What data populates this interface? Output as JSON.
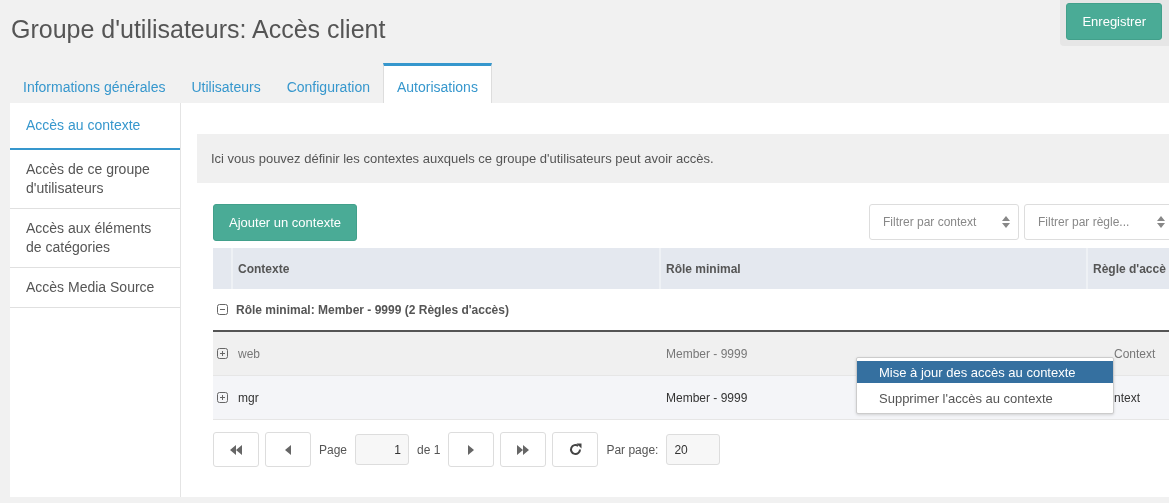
{
  "page_title": "Groupe d'utilisateurs: Accès client",
  "save_button": "Enregistrer",
  "tabs": [
    {
      "label": "Informations générales",
      "selected": false
    },
    {
      "label": "Utilisateurs",
      "selected": false
    },
    {
      "label": "Configuration",
      "selected": false
    },
    {
      "label": "Autorisations",
      "selected": true
    }
  ],
  "sidebar": {
    "items": [
      {
        "label": "Accès au contexte",
        "selected": true
      },
      {
        "label": "Accès de ce groupe d'utilisateurs",
        "selected": false
      },
      {
        "label": "Accès aux éléments de catégories",
        "selected": false
      },
      {
        "label": "Accès Media Source",
        "selected": false
      }
    ]
  },
  "description": "Ici vous pouvez définir les contextes auxquels ce groupe d'utilisateurs peut avoir accès.",
  "add_button": "Ajouter un contexte",
  "filters": [
    {
      "placeholder": "Filtrer par context"
    },
    {
      "placeholder": "Filtrer par règle..."
    }
  ],
  "table": {
    "columns": [
      "Contexte",
      "Rôle minimal",
      "Règle d'accè"
    ],
    "group": {
      "label": "Rôle minimal: Member - 9999 (2 Règles d'accès)",
      "expanded": true
    },
    "rows": [
      {
        "cells": [
          "web",
          "Member - 9999",
          "Context"
        ],
        "expanded": false,
        "hovered": true
      },
      {
        "cells": [
          "mgr",
          "Member - 9999",
          "ntext"
        ],
        "expanded": false,
        "hovered": false
      }
    ]
  },
  "context_menu": [
    {
      "label": "Mise à jour des accès au contexte",
      "selected": true
    },
    {
      "label": "Supprimer l'accès au contexte",
      "selected": false
    }
  ],
  "pagination": {
    "page_label": "Page",
    "page": "1",
    "of_label": "de 1",
    "per_page_label": "Par page:",
    "per_page": "20"
  }
}
